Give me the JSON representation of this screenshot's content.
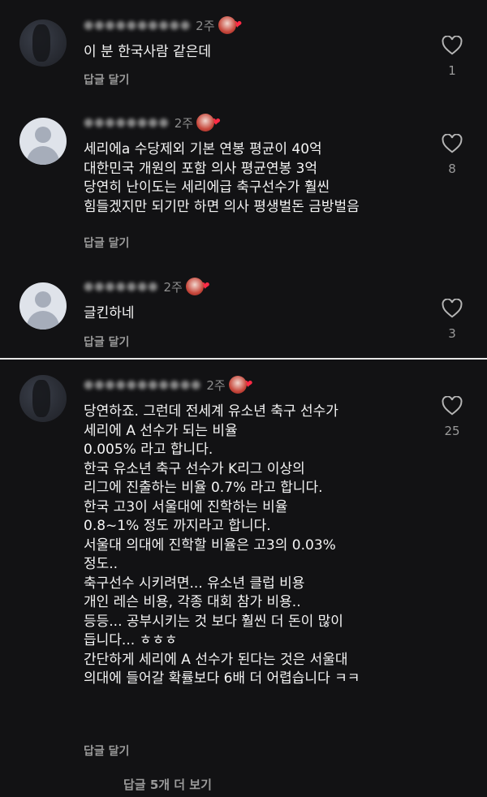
{
  "comments": [
    {
      "username": "●●●●●●●●●●",
      "time": "2주",
      "text": "이 분 한국사람 같은데",
      "reply_label": "답글 달기",
      "likes": "1"
    },
    {
      "username": "●●●●●●●●",
      "time": "2주",
      "text": "세리에a 수당제외 기본 연봉 평균이 40억\n대한민국 개원의 포함 의사 평균연봉 3억\n당연히 난이도는 세리에급 축구선수가 훨씬\n힘들겠지만 되기만 하면 의사 평생벌돈 금방벌음",
      "reply_label": "답글 달기",
      "likes": "8"
    },
    {
      "username": "●●●●●●●",
      "time": "2주",
      "text": "글킨하네",
      "reply_label": "답글 달기",
      "likes": "3"
    },
    {
      "username": "●●●●●●●●●●●",
      "time": "2주",
      "text": "당연하죠. 그런데 전세계 유소년 축구 선수가\n세리에 A 선수가 되는 비율\n0.005% 라고 합니다.\n한국 유소년 축구 선수가 K리그 이상의\n리그에 진출하는 비율 0.7% 라고 합니다.\n한국 고3이 서울대에 진학하는 비율\n0.8~1% 정도 까지라고 합니다.\n서울대 의대에 진학할 비율은 고3의 0.03%\n정도..\n축구선수 시키려면... 유소년 클럽 비용\n개인 레슨 비용, 각종 대회 참가 비용..\n등등... 공부시키는 것 보다 훨씬 더 돈이 많이\n듭니다... ㅎㅎㅎ\n간단하게 세리에 A 선수가 된다는 것은 서울대\n의대에 들어갈 확률보다 6배 더 어렵습니다 ㅋㅋ",
      "reply_label": "답글 달기",
      "likes": "25"
    }
  ],
  "view_more": "답글 5개 더 보기",
  "icons": {
    "like": "heart-outline-icon",
    "badge_heart": "red-heart-icon"
  },
  "colors": {
    "background": "#121214",
    "heart": "#ff2a45"
  }
}
